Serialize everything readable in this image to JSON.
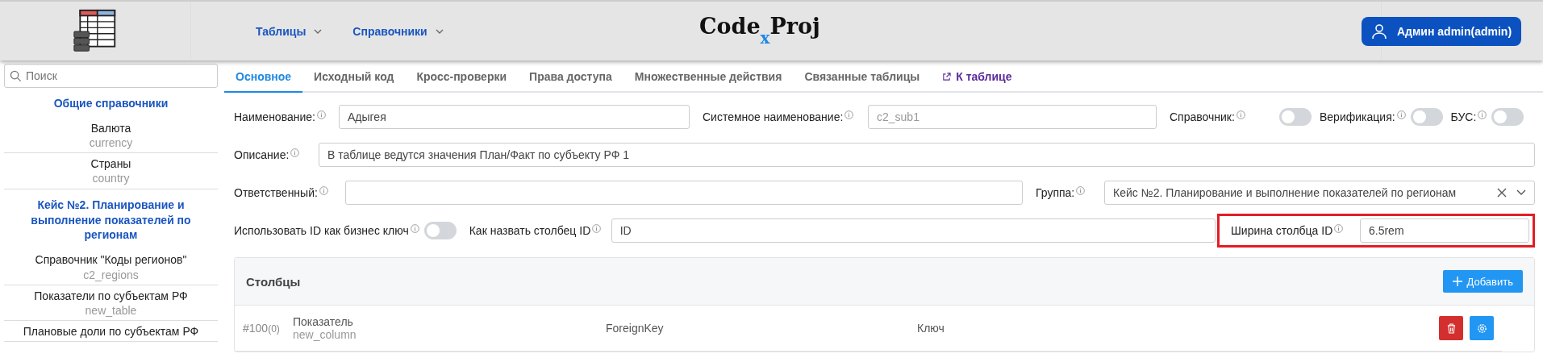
{
  "header": {
    "logo_title": "Code",
    "logo_mark": "x",
    "logo_title_2": "Proj",
    "nav": [
      {
        "label": "Таблицы"
      },
      {
        "label": "Справочники"
      }
    ],
    "user_button": "Админ admin(admin)"
  },
  "sidebar": {
    "search": {
      "placeholder": "Поиск"
    },
    "groups": [
      {
        "title": "Общие справочники",
        "items": [
          {
            "name": "Валюта",
            "code": "currency"
          },
          {
            "name": "Страны",
            "code": "country"
          }
        ]
      },
      {
        "title": "Кейс №2. Планирование и выполнение показателей по регионам",
        "items": [
          {
            "name": "Справочник \"Коды регионов\"",
            "code": "c2_regions"
          },
          {
            "name": "Показатели по субъектам РФ",
            "code": "new_table"
          },
          {
            "name": "Плановые доли по субъектам РФ"
          }
        ]
      }
    ]
  },
  "tabs": [
    {
      "label": "Основное",
      "selected": true,
      "kind": "tab"
    },
    {
      "label": "Исходный код",
      "selected": false,
      "kind": "tab"
    },
    {
      "label": "Кросс-проверки",
      "selected": false,
      "kind": "tab"
    },
    {
      "label": "Права доступа",
      "selected": false,
      "kind": "tab"
    },
    {
      "label": "Множественные действия",
      "selected": false,
      "kind": "tab"
    },
    {
      "label": "Связанные таблицы",
      "selected": false,
      "kind": "tab"
    },
    {
      "label": "К таблице",
      "selected": false,
      "kind": "link"
    }
  ],
  "form": {
    "name": {
      "label": "Наименование:",
      "value": "Адыгея"
    },
    "system_name": {
      "label": "Системное наименование:",
      "value": "c2_sub1",
      "disabled": true
    },
    "switches": [
      {
        "label": "Справочник:",
        "on": false
      },
      {
        "label": "Верификация:",
        "on": false
      },
      {
        "label": "БУС:",
        "on": false
      }
    ],
    "description": {
      "label": "Описание:",
      "value": "В таблице ведутся значения План/Факт по субъекту РФ 1"
    },
    "responsible": {
      "label": "Ответственный:"
    },
    "group": {
      "label": "Группа:",
      "value": "Кейс №2. Планирование и выполнение показателей по регионам"
    },
    "id_business_key": {
      "label": "Использовать ID как бизнес ключ",
      "on": false
    },
    "id_column_name": {
      "label": "Как назвать столбец ID",
      "value": "ID"
    },
    "id_column_width": {
      "label": "Ширина столбца ID",
      "value": "6.5rem",
      "highlighted": true
    }
  },
  "columns_card": {
    "title": "Столбцы",
    "add_button": "Добавить",
    "rows": [
      {
        "number": "#100",
        "count": "(0)",
        "name": "Показатель",
        "code": "new_column",
        "type": "ForeignKey",
        "kind_label": "Ключ"
      }
    ]
  }
}
